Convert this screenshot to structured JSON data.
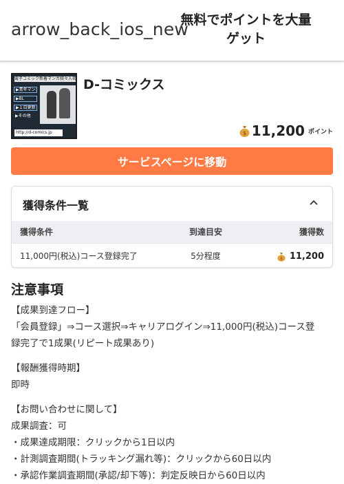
{
  "header": {
    "back_label": "arrow_back_ios_new",
    "title": "無料でポイントを大量ゲット"
  },
  "offer": {
    "name": "D-コミックス",
    "thumbnail": {
      "banner": "電子コミック新着マンガ続々入荷 17:00更新",
      "menu": [
        "▶青年マンガ",
        "▶BL",
        "▶１日更新",
        "▶その他"
      ],
      "url": "http://d-comics.jp"
    },
    "points": "11,200",
    "points_unit": "ポイント",
    "cta_label": "サービスページに移動"
  },
  "conditions": {
    "title": "獲得条件一覧",
    "columns": [
      "獲得条件",
      "到達目安",
      "獲得数"
    ],
    "rows": [
      {
        "condition": "11,000円(税込)コース登録完了",
        "eta": "5分程度",
        "amount": "11,200"
      }
    ]
  },
  "notes": {
    "title": "注意事項",
    "flow_heading": "【成果到達フロー】",
    "flow_line1": "「会員登録」⇒コース選択⇒キャリアログイン⇒11,000円(税込)コース登",
    "flow_line2": "録完了で1成果(リピート成果あり)",
    "reward_heading": "【報酬獲得時期】",
    "reward_value": "即時",
    "inquiry_heading": "【お問い合わせに関して】",
    "inquiry_lines": [
      "成果調査：可",
      "・成果達成期限：クリックから1日以内",
      "・計測調査期間(トラッキング漏れ等)：クリックから60日以内",
      "・承認作業調査期間(承認/却下等)：判定反映日から60日以内"
    ]
  },
  "colors": {
    "accent": "#ff7a45",
    "coin": "#e2a23b",
    "table_header_bg": "#edeff2"
  }
}
